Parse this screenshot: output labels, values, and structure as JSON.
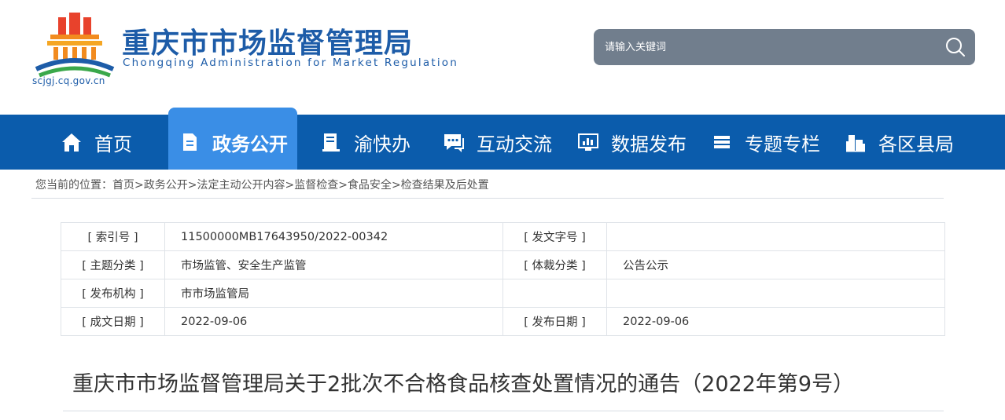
{
  "header": {
    "title": "重庆市市场监督管理局",
    "title_en": "Chongqing  Administration for Market Regulation",
    "url": "scjgj.cq.gov.cn",
    "search_placeholder": "请输入关键词",
    "search_icon": "search-icon"
  },
  "nav": {
    "items": [
      {
        "label": "首页",
        "icon": "home-icon"
      },
      {
        "label": "政务公开",
        "icon": "document-icon"
      },
      {
        "label": "渝快办",
        "icon": "book-icon"
      },
      {
        "label": "互动交流",
        "icon": "chat-icon"
      },
      {
        "label": "数据发布",
        "icon": "chart-monitor-icon"
      },
      {
        "label": "专题专栏",
        "icon": "layers-icon"
      },
      {
        "label": "各区县局",
        "icon": "buildings-icon"
      }
    ],
    "active_index": 1
  },
  "breadcrumb": {
    "prefix": "您当前的位置：",
    "items": [
      "首页",
      "政务公开",
      "法定主动公开内容",
      "监督检查",
      "食品安全",
      "检查结果及后处置"
    ],
    "separator": ">"
  },
  "meta": {
    "rows": [
      {
        "k1": "[ 索引号 ]",
        "v1": "11500000MB17643950/2022-00342",
        "k2": "[ 发文字号 ]",
        "v2": ""
      },
      {
        "k1": "[ 主题分类 ]",
        "v1": "市场监管、安全生产监管",
        "k2": "[ 体裁分类 ]",
        "v2": "公告公示"
      },
      {
        "k1": "[ 发布机构 ]",
        "v1": "市市场监管局",
        "k2": "",
        "v2": ""
      },
      {
        "k1": "[ 成文日期 ]",
        "v1": "2022-09-06",
        "k2": "[ 发布日期 ]",
        "v2": "2022-09-06"
      }
    ]
  },
  "article": {
    "title": "重庆市市场监督管理局关于2批次不合格食品核查处置情况的通告（2022年第9号）"
  },
  "colors": {
    "brand_blue": "#0b5cac",
    "active_tab": "#3a8ee6",
    "search_bg": "#717e8d"
  }
}
